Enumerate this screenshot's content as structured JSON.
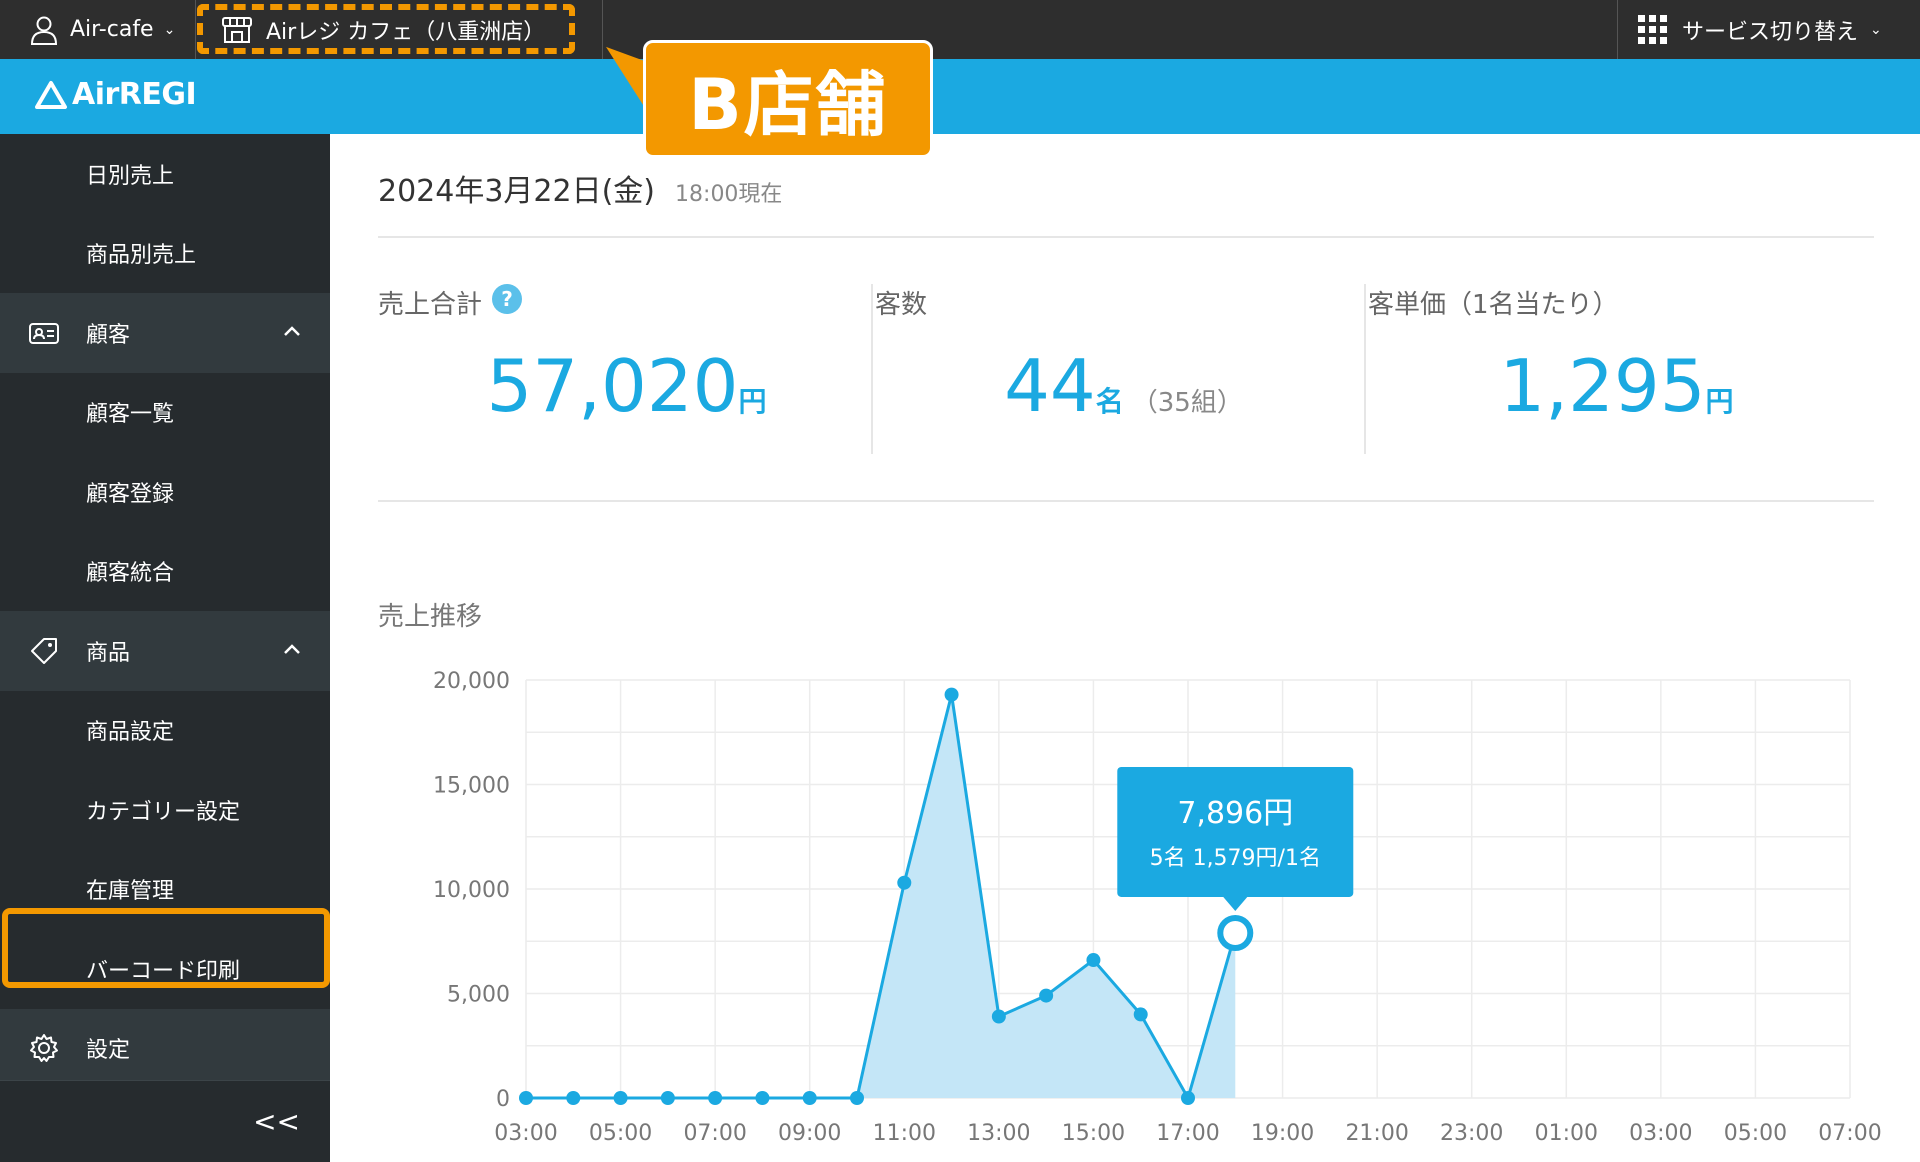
{
  "topbar": {
    "account_label": "Air-cafe",
    "store_label": "Airレジ カフェ（八重洲店）",
    "service_label": "サービス切り替え"
  },
  "header": {
    "logo_text": "AirREGI"
  },
  "callout": {
    "text": "B店舗"
  },
  "sidebar": {
    "items": [
      {
        "label": "日別売上",
        "kind": "sub"
      },
      {
        "label": "商品別売上",
        "kind": "sub"
      },
      {
        "label": "顧客",
        "kind": "section",
        "icon": "customer-card-icon"
      },
      {
        "label": "顧客一覧",
        "kind": "sub"
      },
      {
        "label": "顧客登録",
        "kind": "sub"
      },
      {
        "label": "顧客統合",
        "kind": "sub"
      },
      {
        "label": "商品",
        "kind": "section",
        "icon": "tag-icon"
      },
      {
        "label": "商品設定",
        "kind": "sub"
      },
      {
        "label": "カテゴリー設定",
        "kind": "sub",
        "highlighted": true
      },
      {
        "label": "在庫管理",
        "kind": "sub"
      },
      {
        "label": "バーコード印刷",
        "kind": "sub"
      },
      {
        "label": "設定",
        "kind": "section",
        "icon": "gear-icon"
      }
    ],
    "collapse_label": "<<"
  },
  "main": {
    "date": "2024年3月22日(金)",
    "as_of": "18:00現在",
    "stats": {
      "sales": {
        "label": "売上合計",
        "value": "57,020",
        "unit": "円"
      },
      "customers": {
        "label": "客数",
        "value": "44",
        "unit": "名",
        "extra": "（35組）"
      },
      "avg": {
        "label": "客単価（1名当たり）",
        "value": "1,295",
        "unit": "円"
      }
    },
    "chart_title": "売上推移"
  },
  "colors": {
    "accent": "#1ba9e1",
    "highlight": "#f39800",
    "sidebar": "#262b2e"
  },
  "chart_data": {
    "type": "area",
    "title": "売上推移",
    "x_labels": [
      "03:00",
      "05:00",
      "07:00",
      "09:00",
      "11:00",
      "13:00",
      "15:00",
      "17:00",
      "19:00",
      "21:00",
      "23:00",
      "01:00",
      "03:00",
      "05:00",
      "07:00"
    ],
    "x": [
      "03:00",
      "04:00",
      "05:00",
      "06:00",
      "07:00",
      "08:00",
      "09:00",
      "10:00",
      "11:00",
      "12:00",
      "13:00",
      "14:00",
      "15:00",
      "16:00",
      "17:00",
      "18:00"
    ],
    "values": [
      0,
      0,
      0,
      0,
      0,
      0,
      0,
      0,
      10300,
      19300,
      3900,
      4900,
      6600,
      4000,
      0,
      7896
    ],
    "ylim": [
      0,
      20000
    ],
    "y_ticks": [
      "0",
      "5,000",
      "10,000",
      "15,000",
      "20,000"
    ],
    "grid": true,
    "tooltip": {
      "value_label": "7,896円",
      "detail_label": "5名 1,579円/1名"
    }
  }
}
